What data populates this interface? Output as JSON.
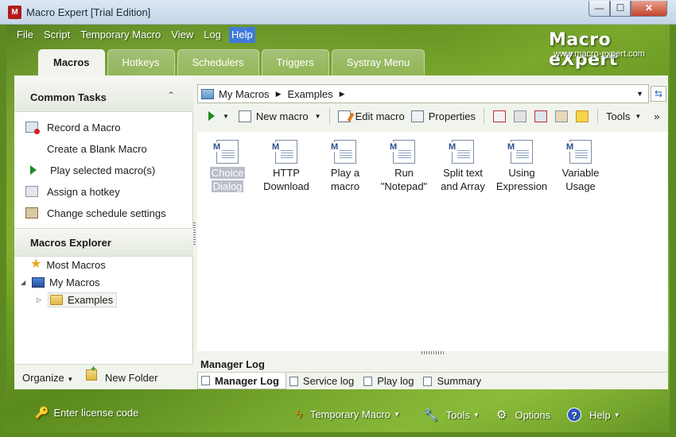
{
  "window": {
    "title": "Macro Expert [Trial Edition]",
    "icon_letter": "M",
    "controls": {
      "minimize": "—",
      "maximize": "☐",
      "close": "✕"
    }
  },
  "brand": {
    "name": "Macro eXpert",
    "url": "www.macro-expert.com"
  },
  "menu": [
    {
      "label": "File"
    },
    {
      "label": "Script"
    },
    {
      "label": "Temporary Macro"
    },
    {
      "label": "View"
    },
    {
      "label": "Log"
    },
    {
      "label": "Help",
      "active": true
    }
  ],
  "tabs": [
    {
      "label": "Macros",
      "active": true
    },
    {
      "label": "Hotkeys"
    },
    {
      "label": "Schedulers"
    },
    {
      "label": "Triggers"
    },
    {
      "label": "Systray Menu"
    }
  ],
  "common_tasks": {
    "title": "Common Tasks",
    "collapse_glyph": "⌃",
    "items": [
      {
        "label": "Record a Macro",
        "icon": "record-icon"
      },
      {
        "label": "Create a Blank Macro",
        "icon": ""
      },
      {
        "label": "Play selected macro(s)",
        "icon": "play-icon"
      },
      {
        "label": "Assign a hotkey",
        "icon": "keyboard-icon"
      },
      {
        "label": "Change schedule settings",
        "icon": "schedule-icon"
      }
    ]
  },
  "explorer": {
    "title": "Macros Explorer",
    "items": [
      {
        "label": "Most Macros",
        "icon": "star-icon"
      },
      {
        "label": "My Macros",
        "icon": "computer-icon"
      },
      {
        "label": "Examples",
        "icon": "folder-icon",
        "selected": true
      }
    ]
  },
  "left_footer": {
    "organize": "Organize",
    "new_folder": "New Folder"
  },
  "address": {
    "segments": [
      "My Macros",
      "Examples"
    ]
  },
  "toolbar": {
    "new_macro": "New macro",
    "edit_macro": "Edit macro",
    "properties": "Properties",
    "tools": "Tools",
    "overflow": "»"
  },
  "files": [
    {
      "line1": "Choice",
      "line2": "Dialog",
      "selected": true
    },
    {
      "line1": "HTTP",
      "line2": "Download"
    },
    {
      "line1": "Play a",
      "line2": "macro"
    },
    {
      "line1": "Run",
      "line2": "\"Notepad\""
    },
    {
      "line1": "Split text",
      "line2": "and Array"
    },
    {
      "line1": "Using",
      "line2": "Expression"
    },
    {
      "line1": "Variable",
      "line2": "Usage"
    }
  ],
  "log": {
    "label": "Manager Log",
    "tabs": [
      {
        "label": "Manager Log",
        "active": true
      },
      {
        "label": "Service log"
      },
      {
        "label": "Play log"
      },
      {
        "label": "Summary"
      }
    ]
  },
  "bottom": {
    "license": "Enter license code",
    "temporary_macro": "Temporary Macro",
    "tools": "Tools",
    "options": "Options",
    "help": "Help"
  },
  "colors": {
    "accent": "#3f7bd9",
    "banner_green": "#6a9a24",
    "selection": "#b9bec8"
  }
}
